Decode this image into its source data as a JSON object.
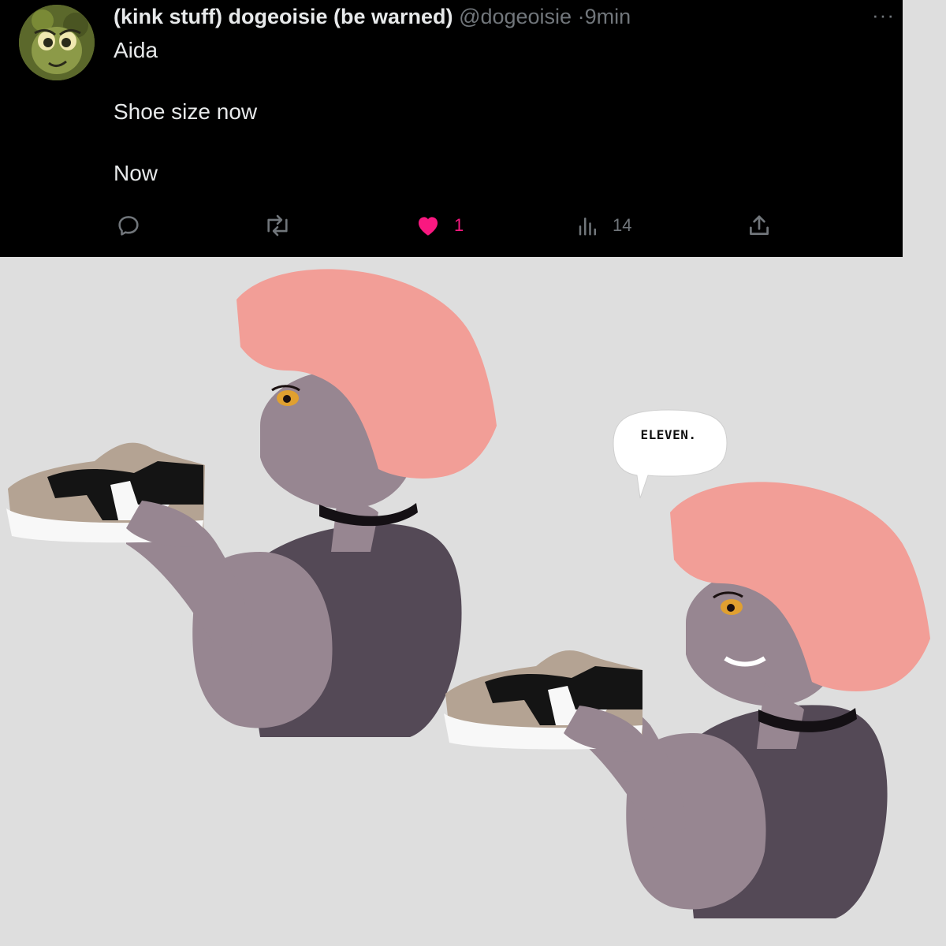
{
  "tweet": {
    "display_name": "(kink stuff) dogeoisie (be warned)",
    "handle": "@dogeoisie",
    "separator": "·",
    "time": "9min",
    "more_label": "···",
    "avatar_icon": "avatar-icon",
    "body_lines": [
      "Aida",
      "Shoe size now",
      "Now"
    ],
    "actions": {
      "reply": {
        "icon": "reply-icon"
      },
      "repost": {
        "icon": "repost-icon"
      },
      "like": {
        "icon": "heart-icon",
        "count": "1",
        "liked": true
      },
      "views": {
        "icon": "views-icon",
        "count": "14"
      },
      "share": {
        "icon": "share-icon"
      }
    }
  },
  "comic": {
    "speech_bubble": "ELEVEN."
  },
  "colors": {
    "tweet_background": "#000000",
    "page_background": "#dedede",
    "text_primary": "#e7e9ea",
    "text_secondary": "#71767b",
    "like_pink": "#f91880",
    "hair": "#f29e97",
    "skin": "#968690",
    "top": "#554a57"
  }
}
